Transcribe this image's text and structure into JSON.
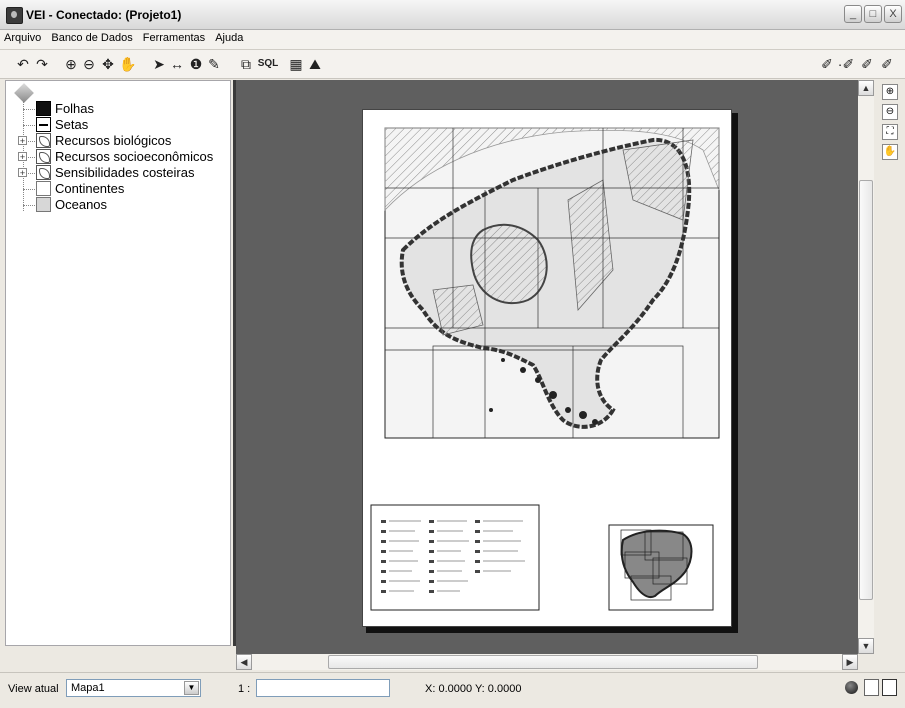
{
  "window": {
    "title": "VEI - Conectado:  (Projeto1)",
    "buttons": {
      "minimize": "_",
      "maximize": "□",
      "close": "X"
    }
  },
  "menu": [
    "Arquivo",
    "Banco de Dados",
    "Ferramentas",
    "Ajuda"
  ],
  "toolbar": {
    "undo": "↶",
    "redo": "↷",
    "zoom_in": "⊕",
    "zoom_out": "⊖",
    "pan": "✥",
    "hand": "✋",
    "select": "➤",
    "measure": "↔",
    "info": "❶",
    "edit": "✎",
    "layer_query": "⧉",
    "sql": "SQL",
    "table": "▦",
    "chart": "⛰",
    "draw_tools": [
      "✐",
      "·✐",
      "✐",
      "✐"
    ]
  },
  "layers": [
    {
      "label": "Folhas",
      "swatch": "black",
      "expandable": false
    },
    {
      "label": "Setas",
      "swatch": "line",
      "expandable": false
    },
    {
      "label": "Recursos biológicos",
      "swatch": "layers",
      "expandable": true
    },
    {
      "label": "Recursos socioeconômicos",
      "swatch": "layers",
      "expandable": true
    },
    {
      "label": "Sensibilidades costeiras",
      "swatch": "layers",
      "expandable": true
    },
    {
      "label": "Continentes",
      "swatch": "white",
      "expandable": false
    },
    {
      "label": "Oceanos",
      "swatch": "gray",
      "expandable": false
    }
  ],
  "tree_expander": "+",
  "scroll": {
    "up": "▲",
    "down": "▼",
    "left": "◀",
    "right": "▶"
  },
  "side_tools": [
    "⊕",
    "⊖",
    "⛶",
    "✋"
  ],
  "status": {
    "view_label": "View atual",
    "view_value": "Mapa1",
    "dropdown": "▼",
    "scale_label": "1 :",
    "scale_value": "",
    "coords": "X: 0.0000  Y: 0.0000"
  },
  "colors": {
    "canvas_bg": "#5f5f5f",
    "coast": "#333333",
    "land": "#e6e6e6",
    "hatch": "#8a8a8a"
  }
}
